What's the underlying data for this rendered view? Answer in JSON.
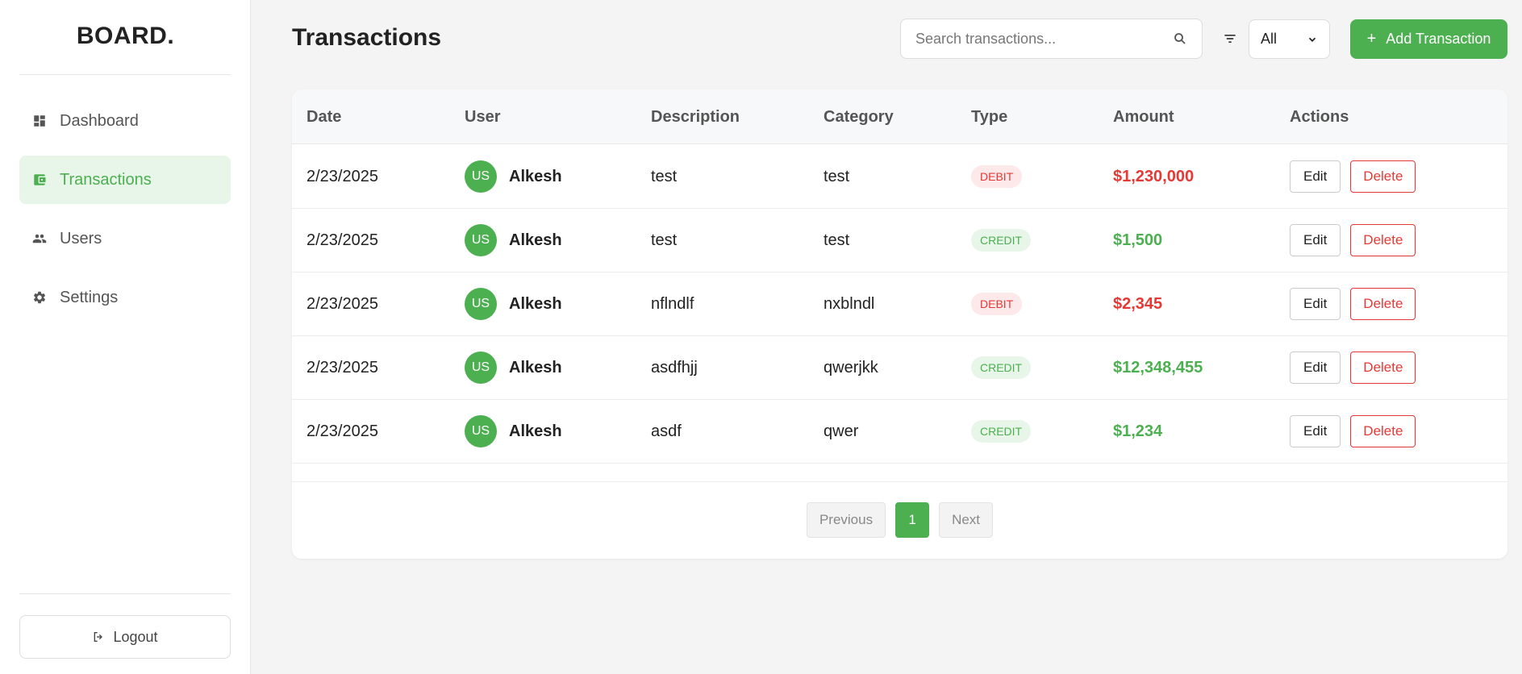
{
  "brand": "BOARD.",
  "sidebar": {
    "items": [
      {
        "label": "Dashboard",
        "icon": "dashboard-icon",
        "active": false
      },
      {
        "label": "Transactions",
        "icon": "wallet-icon",
        "active": true
      },
      {
        "label": "Users",
        "icon": "users-icon",
        "active": false
      },
      {
        "label": "Settings",
        "icon": "gear-icon",
        "active": false
      }
    ],
    "logout_label": "Logout"
  },
  "header": {
    "title": "Transactions",
    "search_placeholder": "Search transactions...",
    "filter_value": "All",
    "add_label": "Add Transaction"
  },
  "table": {
    "columns": [
      "Date",
      "User",
      "Description",
      "Category",
      "Type",
      "Amount",
      "Actions"
    ],
    "rows": [
      {
        "date": "2/23/2025",
        "avatar": "US",
        "user": "Alkesh",
        "description": "test",
        "category": "test",
        "type": "DEBIT",
        "amount": "$1,230,000",
        "edit": "Edit",
        "delete": "Delete"
      },
      {
        "date": "2/23/2025",
        "avatar": "US",
        "user": "Alkesh",
        "description": "test",
        "category": "test",
        "type": "CREDIT",
        "amount": "$1,500",
        "edit": "Edit",
        "delete": "Delete"
      },
      {
        "date": "2/23/2025",
        "avatar": "US",
        "user": "Alkesh",
        "description": "nflndlf",
        "category": "nxblndl",
        "type": "DEBIT",
        "amount": "$2,345",
        "edit": "Edit",
        "delete": "Delete"
      },
      {
        "date": "2/23/2025",
        "avatar": "US",
        "user": "Alkesh",
        "description": "asdfhjj",
        "category": "qwerjkk",
        "type": "CREDIT",
        "amount": "$12,348,455",
        "edit": "Edit",
        "delete": "Delete"
      },
      {
        "date": "2/23/2025",
        "avatar": "US",
        "user": "Alkesh",
        "description": "asdf",
        "category": "qwer",
        "type": "CREDIT",
        "amount": "$1,234",
        "edit": "Edit",
        "delete": "Delete"
      }
    ]
  },
  "pagination": {
    "previous": "Previous",
    "current": "1",
    "next": "Next"
  },
  "colors": {
    "accent": "#4caf50",
    "debit": "#e53935",
    "background": "#f4f4f4"
  }
}
